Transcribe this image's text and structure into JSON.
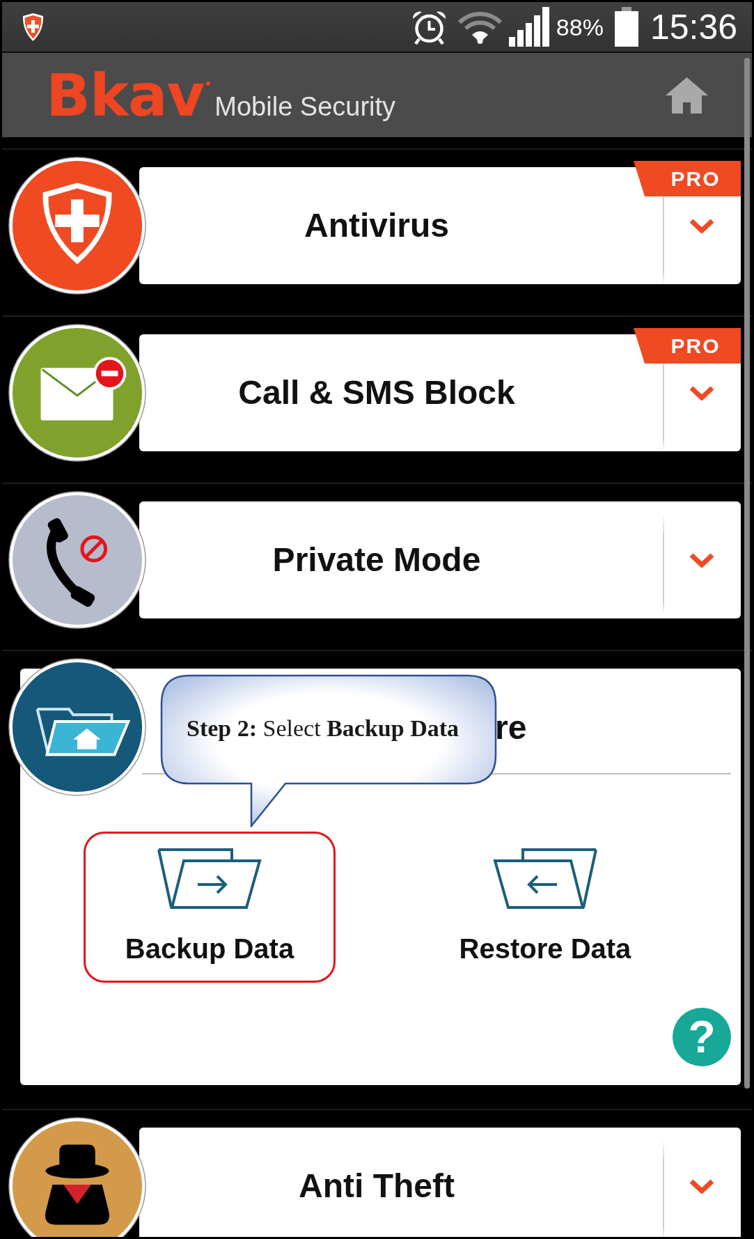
{
  "status_bar": {
    "battery": "88%",
    "time": "15:36"
  },
  "header": {
    "logo": "Bkav",
    "subtitle": "Mobile Security"
  },
  "features": [
    {
      "title": "Antivirus",
      "color": "#f04a23",
      "badge": "PRO",
      "expanded": false
    },
    {
      "title": "Call & SMS Block",
      "color": "#80a22c",
      "badge": "PRO",
      "expanded": false
    },
    {
      "title": "Private Mode",
      "color": "#b6bccb",
      "expanded": false
    },
    {
      "title": "re",
      "color": "#15587a",
      "expanded": true,
      "actions": [
        {
          "label": "Backup Data",
          "kind": "backup",
          "highlighted": true
        },
        {
          "label": "Restore Data",
          "kind": "restore",
          "highlighted": false
        }
      ],
      "help_button": "?"
    },
    {
      "title": "Anti Theft",
      "color": "#d39a4c",
      "expanded": false
    }
  ],
  "callout": {
    "text": "**Step 2:** Select **Backup Data**"
  }
}
